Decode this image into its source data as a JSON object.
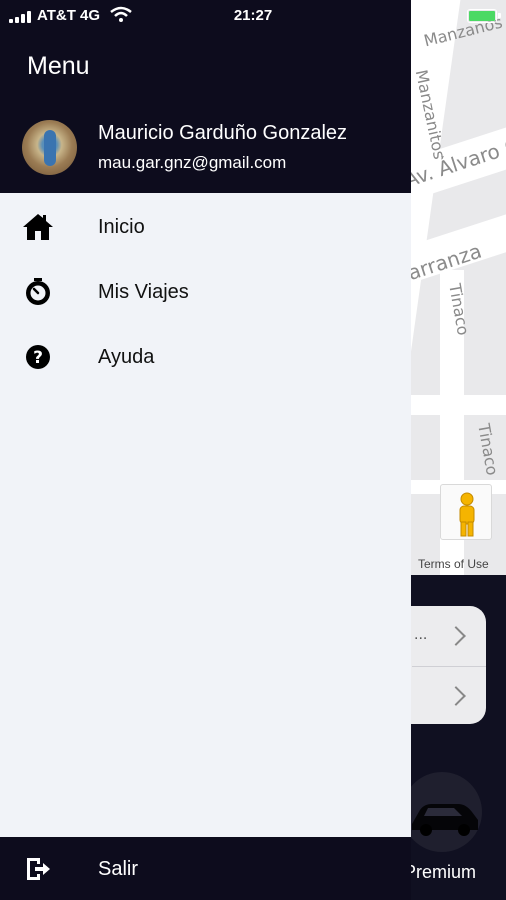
{
  "status_bar": {
    "carrier": "AT&T 4G",
    "time": "21:27",
    "battery": "100%"
  },
  "map": {
    "streets": [
      "Manzanos",
      "Manzanitos",
      "Av. Álvaro O",
      "Carranza",
      "Tinaco",
      "Tinaco"
    ],
    "terms": "Terms of Use"
  },
  "ride_panel": {
    "option_dots": "...",
    "vehicle_label": "Premium"
  },
  "drawer": {
    "title": "Menu",
    "user": {
      "name": "Mauricio Garduño Gonzalez",
      "email": "mau.gar.gnz@gmail.com"
    },
    "items": [
      {
        "label": "Inicio",
        "icon": "home-icon"
      },
      {
        "label": "Mis Viajes",
        "icon": "clock-icon"
      },
      {
        "label": "Ayuda",
        "icon": "help-icon"
      }
    ],
    "footer": {
      "label": "Salir",
      "icon": "logout-icon"
    }
  },
  "colors": {
    "header": "#0d0c1d",
    "drawer_bg": "#f1f3f8",
    "battery": "#4cd964"
  }
}
